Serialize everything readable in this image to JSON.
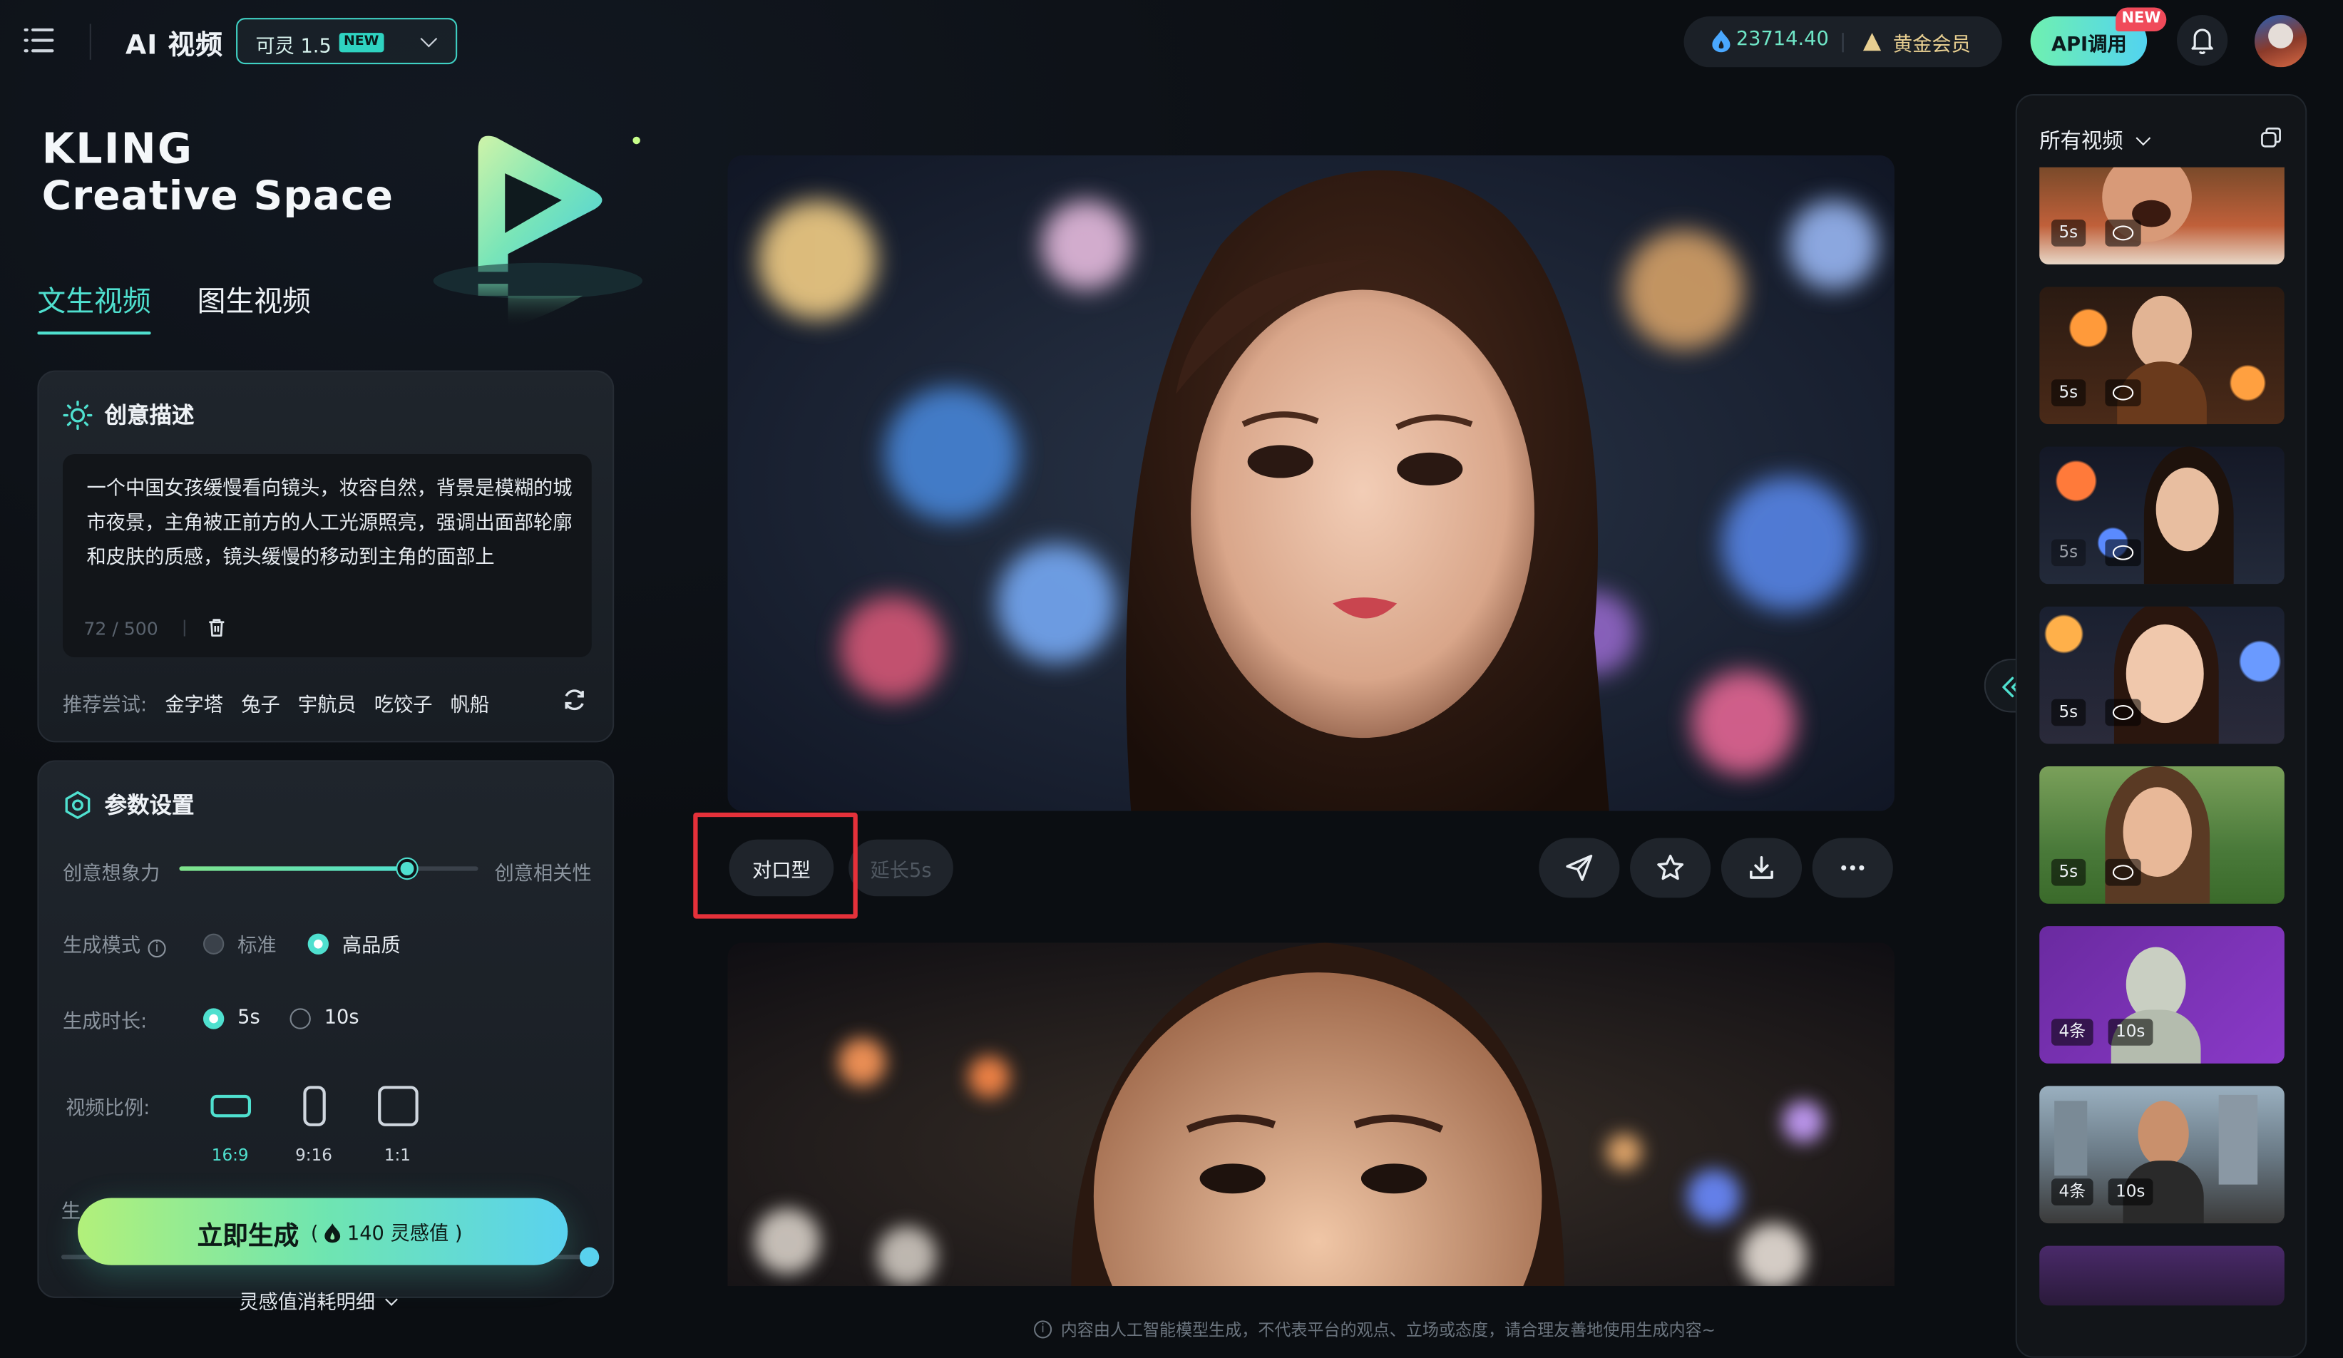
{
  "header": {
    "app_title": "AI 视频",
    "model": {
      "label": "可灵 1.5",
      "badge": "NEW"
    },
    "credits": "23714.40",
    "membership": "黄金会员",
    "api_button": "API调用",
    "api_badge": "NEW"
  },
  "brand": {
    "line1": "KLING",
    "line2": "Creative Space"
  },
  "tabs": [
    {
      "label": "文生视频",
      "active": true
    },
    {
      "label": "图生视频",
      "active": false
    }
  ],
  "prompt_card": {
    "title": "创意描述",
    "text": "一个中国女孩缓慢看向镜头，妆容自然，背景是模糊的城市夜景，主角被正前方的人工光源照亮，强调出面部轮廓和皮肤的质感，镜头缓慢的移动到主角的面部上",
    "counter": "72 / 500",
    "suggest_label": "推荐尝试:",
    "suggestions": [
      "金字塔",
      "兔子",
      "宇航员",
      "吃饺子",
      "帆船"
    ]
  },
  "params_card": {
    "title": "参数设置",
    "slider": {
      "left_label": "创意想象力",
      "right_label": "创意相关性",
      "value": 0.76
    },
    "mode": {
      "label": "生成模式",
      "options": [
        {
          "label": "标准",
          "selected": false,
          "disabled": true
        },
        {
          "label": "高品质",
          "selected": true
        }
      ]
    },
    "duration": {
      "label": "生成时长:",
      "options": [
        {
          "label": "5s",
          "selected": true
        },
        {
          "label": "10s",
          "selected": false
        }
      ]
    },
    "ratio": {
      "label": "视频比例:",
      "options": [
        {
          "label": "16:9",
          "selected": true
        },
        {
          "label": "9:16",
          "selected": false
        },
        {
          "label": "1:1",
          "selected": false
        }
      ]
    },
    "hidden_label": "生"
  },
  "generate": {
    "label": "立即生成",
    "cost": "140 灵感值",
    "detail": "灵感值消耗明细"
  },
  "feed": {
    "actions": {
      "lip_sync": "对口型",
      "extend": "延长5s"
    },
    "disclaimer": "内容由人工智能模型生成，不代表平台的观点、立场或态度，请合理友善地使用生成内容~"
  },
  "sidebar": {
    "title": "所有视频",
    "items": [
      {
        "duration": "5s",
        "lip": true
      },
      {
        "duration": "5s",
        "lip": true
      },
      {
        "duration": "5s",
        "lip": true
      },
      {
        "duration": "5s",
        "lip": true
      },
      {
        "duration": "5s",
        "lip": true
      },
      {
        "count": "4条",
        "duration": "10s"
      },
      {
        "count": "4条",
        "duration": "10s"
      }
    ]
  },
  "colors": {
    "accent": "#4fe0cf",
    "highlight_box": "#e5313a",
    "gold": "#e8cf91"
  }
}
